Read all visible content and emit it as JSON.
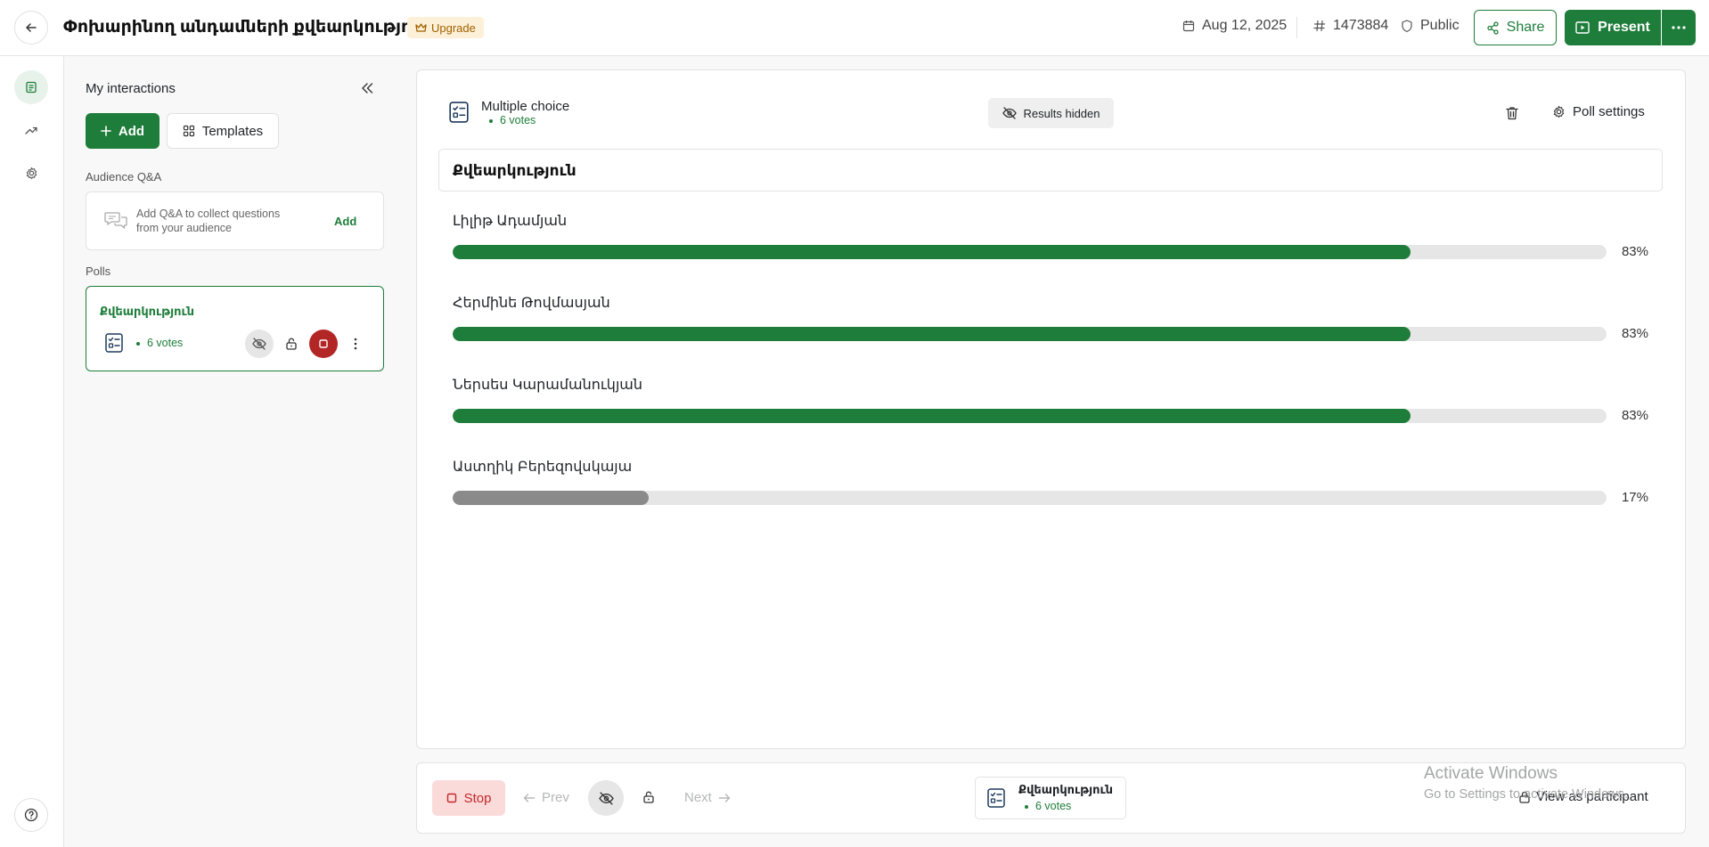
{
  "header": {
    "title": "Փոխարինող անդամների քվեարկություն",
    "upgrade_label": "Upgrade",
    "date": "Aug 12, 2025",
    "event_code": "1473884",
    "visibility": "Public",
    "share_label": "Share",
    "present_label": "Present"
  },
  "sidebar": {
    "heading": "My interactions",
    "add_label": "Add",
    "templates_label": "Templates",
    "qa_section_label": "Audience Q&A",
    "qa_text": "Add Q&A to collect questions from your audience",
    "qa_add_label": "Add",
    "polls_section_label": "Polls",
    "poll_card": {
      "title": "Քվեարկություն",
      "votes": "6 votes"
    }
  },
  "poll": {
    "type_label": "Multiple choice",
    "votes": "6 votes",
    "results_hidden_label": "Results hidden",
    "settings_label": "Poll settings",
    "question": "Քվեարկություն",
    "options": [
      {
        "label": "Լիլիթ Ադամյան",
        "percent_text": "83%",
        "percent": 83,
        "color": "#1e7d3a"
      },
      {
        "label": "Հերմինե Թովմասյան",
        "percent_text": "83%",
        "percent": 83,
        "color": "#1e7d3a"
      },
      {
        "label": "Ներսես Կարամանուկյան",
        "percent_text": "83%",
        "percent": 83,
        "color": "#1e7d3a"
      },
      {
        "label": "Աստղիկ Բերեզովսկայա",
        "percent_text": "17%",
        "percent": 17,
        "color": "#8a8a8a"
      }
    ]
  },
  "bottom": {
    "stop_label": "Stop",
    "prev_label": "Prev",
    "next_label": "Next",
    "card_title": "Քվեարկություն",
    "card_votes": "6 votes",
    "participant_label": "View as participant"
  },
  "watermark": {
    "line1": "Activate Windows",
    "line2": "Go to Settings to activate Windows."
  },
  "colors": {
    "accent": "#1e7d3a",
    "stop": "#c22828",
    "upgrade": "#a06200"
  }
}
